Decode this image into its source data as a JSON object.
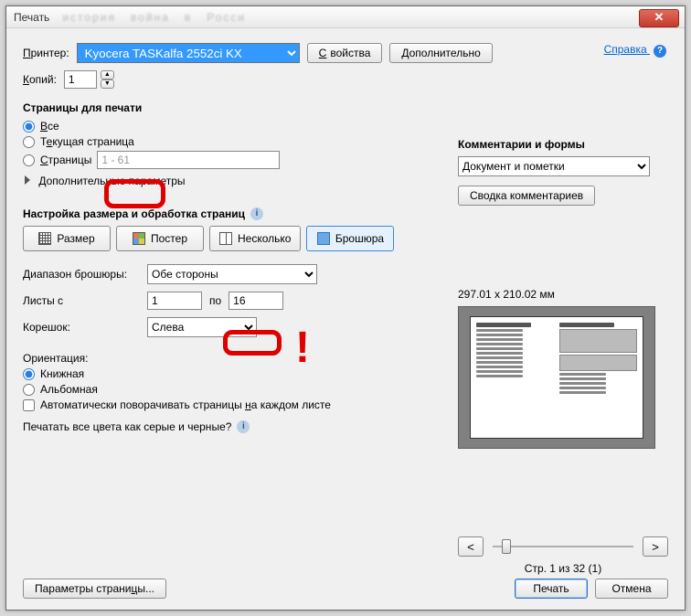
{
  "title": "Печать",
  "help_link": "Справка",
  "printer_label": "Принтер:",
  "printer_value": "Kyocera TASKalfa 2552ci KX",
  "btn_props": "Свойства",
  "btn_more": "Дополнительно",
  "copies_label": "Копий:",
  "copies_value": "1",
  "pages_section": "Страницы для печати",
  "radio_all": "Все",
  "radio_current": "Текущая страница",
  "radio_pages": "Страницы",
  "pages_range": "1 - 61",
  "disclosure": "Дополнительные параметры",
  "sizing_section": "Настройка размера и обработка страниц",
  "seg_size": "Размер",
  "seg_poster": "Постер",
  "seg_multi": "Несколько",
  "seg_booklet": "Брошюра",
  "booklet_range_label": "Диапазон брошюры:",
  "booklet_range_value": "Обе стороны",
  "sheets_label": "Листы с",
  "sheets_from": "1",
  "sheets_to_label": "по",
  "sheets_to": "16",
  "binding_label": "Корешок:",
  "binding_value": "Слева",
  "orient_label": "Ориентация:",
  "orient_book": "Книжная",
  "orient_land": "Альбомная",
  "auto_rotate": "Автоматически поворачивать страницы на каждом листе",
  "gray_q": "Печатать все цвета как серые и черные?",
  "comments_section": "Комментарии и формы",
  "comments_value": "Документ и пометки",
  "summary_btn": "Сводка комментариев",
  "preview_dim": "297.01 x 210.02 мм",
  "nav_prev": "<",
  "nav_next": ">",
  "page_of": "Стр. 1 из 32 (1)",
  "page_setup": "Параметры страницы...",
  "btn_print": "Печать",
  "btn_cancel": "Отмена"
}
